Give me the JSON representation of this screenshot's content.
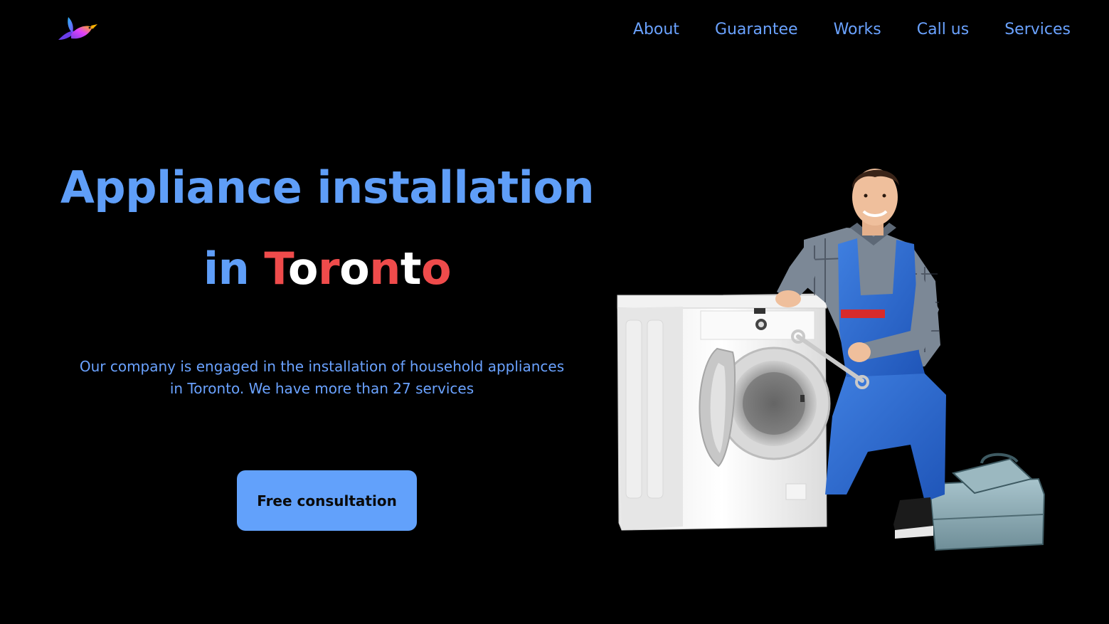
{
  "nav": {
    "items": [
      {
        "label": "About"
      },
      {
        "label": "Guarantee"
      },
      {
        "label": "Works"
      },
      {
        "label": "Call us"
      },
      {
        "label": "Services"
      }
    ]
  },
  "hero": {
    "title_line1": "Appliance installation",
    "title_line2_prefix": "in ",
    "title_line2_letters": [
      "T",
      "o",
      "r",
      "o",
      "n",
      "t",
      "o"
    ],
    "description": "Our company is engaged in the installation of household appliances in Toronto. We have more than 27 services",
    "cta_label": "Free consultation"
  },
  "colors": {
    "background": "#000000",
    "accent_blue": "#5f9ef8",
    "button_blue": "#62a1fb",
    "flag_red": "#ef4b4b",
    "flag_white": "#ffffff"
  },
  "icons": {
    "logo": "hummingbird-logo-icon"
  }
}
